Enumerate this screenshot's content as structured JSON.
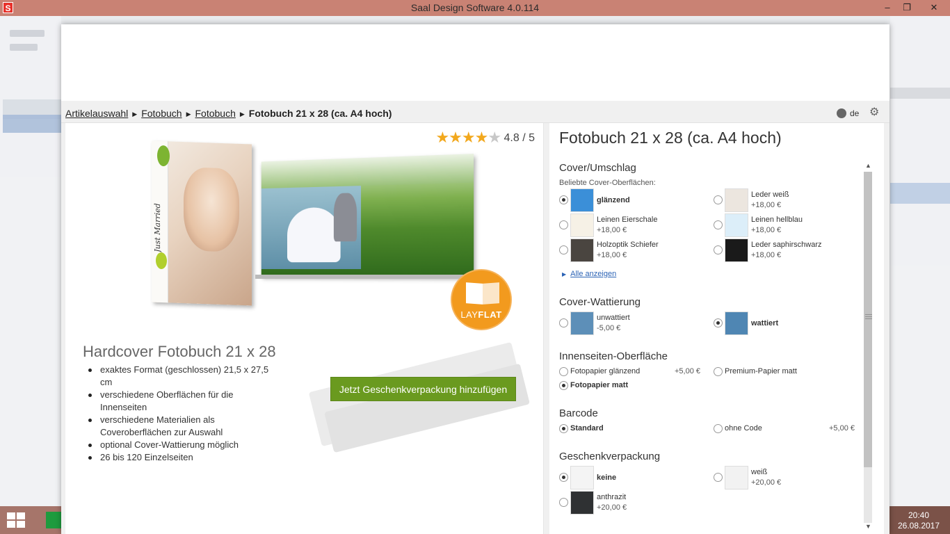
{
  "window": {
    "title": "Saal Design Software 4.0.114",
    "app_icon": "S",
    "controls": {
      "minimize": "–",
      "restore": "❐",
      "close": "✕"
    }
  },
  "taskbar": {
    "time": "20:40",
    "date": "26.08.2017"
  },
  "breadcrumb": {
    "items": [
      "Artikelauswahl",
      "Fotobuch",
      "Fotobuch"
    ],
    "current": "Fotobuch 21 x 28 (ca. A4 hoch)"
  },
  "language": "de",
  "product": {
    "rating_text": "4.8 / 5",
    "rating_value": 4.8,
    "rating_max": 5,
    "cover_spine_text": "Just Married",
    "badge": {
      "light": "LAY",
      "bold": "FLAT"
    },
    "title": "Hardcover Fotobuch 21 x 28",
    "features": [
      "exaktes Format (geschlossen) 21,5 x 27,5 cm",
      "verschiedene Oberflächen für die Innenseiten",
      "verschiedene Materialien als Coveroberflächen zur Auswahl",
      "optional Cover-Wattierung möglich",
      "26 bis 120 Einzelseiten"
    ],
    "gift_button": "Jetzt Geschenkverpackung hinzufügen"
  },
  "config": {
    "title": "Fotobuch 21 x 28 (ca. A4 hoch)",
    "cover": {
      "title": "Cover/Umschlag",
      "subtitle": "Beliebte Cover-Oberflächen:",
      "options": [
        {
          "name": "glänzend",
          "price": "",
          "selected": true,
          "color": "#3b8fd8"
        },
        {
          "name": "Leder weiß",
          "price": "+18,00 €",
          "selected": false,
          "color": "#ece6df"
        },
        {
          "name": "Leinen Eierschale",
          "price": "+18,00 €",
          "selected": false,
          "color": "#f6f1e6"
        },
        {
          "name": "Leinen hellblau",
          "price": "+18,00 €",
          "selected": false,
          "color": "#dceef9"
        },
        {
          "name": "Holzoptik Schiefer",
          "price": "+18,00 €",
          "selected": false,
          "color": "#4a4540"
        },
        {
          "name": "Leder saphirschwarz",
          "price": "+18,00 €",
          "selected": false,
          "color": "#1a1a1a"
        }
      ],
      "show_all": "Alle anzeigen"
    },
    "padding": {
      "title": "Cover-Wattierung",
      "options": [
        {
          "name": "unwattiert",
          "price": "-5,00 €",
          "selected": false,
          "color": "#5d8fb8"
        },
        {
          "name": "wattiert",
          "price": "",
          "selected": true,
          "color": "#4f86b3"
        }
      ]
    },
    "inner": {
      "title": "Innenseiten-Oberfläche",
      "options": [
        {
          "name": "Fotopapier glänzend",
          "price": "+5,00 €",
          "selected": false
        },
        {
          "name": "Premium-Papier matt",
          "price": "",
          "selected": false
        },
        {
          "name": "Fotopapier matt",
          "price": "",
          "selected": true
        }
      ]
    },
    "barcode": {
      "title": "Barcode",
      "options": [
        {
          "name": "Standard",
          "price": "",
          "selected": true
        },
        {
          "name": "ohne Code",
          "price": "+5,00 €",
          "selected": false
        }
      ]
    },
    "gift": {
      "title": "Geschenkverpackung",
      "options": [
        {
          "name": "keine",
          "price": "",
          "selected": true,
          "color": "#f4f4f4"
        },
        {
          "name": "weiß",
          "price": "+20,00 €",
          "selected": false,
          "color": "#f2f2f2"
        },
        {
          "name": "anthrazit",
          "price": "+20,00 €",
          "selected": false,
          "color": "#2f3133"
        }
      ]
    }
  }
}
